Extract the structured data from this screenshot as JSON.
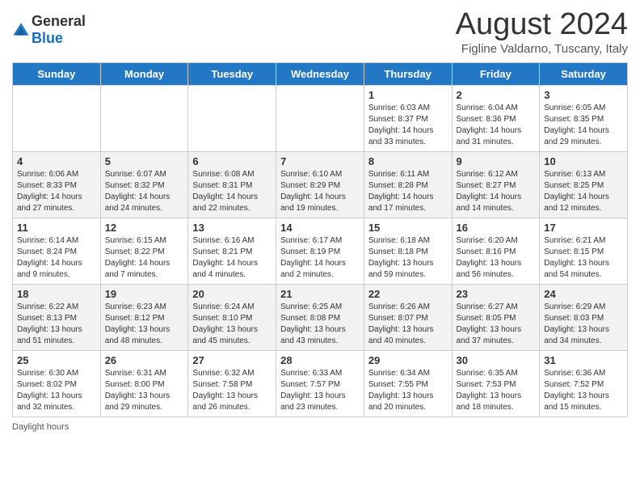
{
  "header": {
    "logo_general": "General",
    "logo_blue": "Blue",
    "title": "August 2024",
    "subtitle": "Figline Valdarno, Tuscany, Italy"
  },
  "days_of_week": [
    "Sunday",
    "Monday",
    "Tuesday",
    "Wednesday",
    "Thursday",
    "Friday",
    "Saturday"
  ],
  "weeks": [
    [
      {
        "day": "",
        "info": ""
      },
      {
        "day": "",
        "info": ""
      },
      {
        "day": "",
        "info": ""
      },
      {
        "day": "",
        "info": ""
      },
      {
        "day": "1",
        "info": "Sunrise: 6:03 AM\nSunset: 8:37 PM\nDaylight: 14 hours and 33 minutes."
      },
      {
        "day": "2",
        "info": "Sunrise: 6:04 AM\nSunset: 8:36 PM\nDaylight: 14 hours and 31 minutes."
      },
      {
        "day": "3",
        "info": "Sunrise: 6:05 AM\nSunset: 8:35 PM\nDaylight: 14 hours and 29 minutes."
      }
    ],
    [
      {
        "day": "4",
        "info": "Sunrise: 6:06 AM\nSunset: 8:33 PM\nDaylight: 14 hours and 27 minutes."
      },
      {
        "day": "5",
        "info": "Sunrise: 6:07 AM\nSunset: 8:32 PM\nDaylight: 14 hours and 24 minutes."
      },
      {
        "day": "6",
        "info": "Sunrise: 6:08 AM\nSunset: 8:31 PM\nDaylight: 14 hours and 22 minutes."
      },
      {
        "day": "7",
        "info": "Sunrise: 6:10 AM\nSunset: 8:29 PM\nDaylight: 14 hours and 19 minutes."
      },
      {
        "day": "8",
        "info": "Sunrise: 6:11 AM\nSunset: 8:28 PM\nDaylight: 14 hours and 17 minutes."
      },
      {
        "day": "9",
        "info": "Sunrise: 6:12 AM\nSunset: 8:27 PM\nDaylight: 14 hours and 14 minutes."
      },
      {
        "day": "10",
        "info": "Sunrise: 6:13 AM\nSunset: 8:25 PM\nDaylight: 14 hours and 12 minutes."
      }
    ],
    [
      {
        "day": "11",
        "info": "Sunrise: 6:14 AM\nSunset: 8:24 PM\nDaylight: 14 hours and 9 minutes."
      },
      {
        "day": "12",
        "info": "Sunrise: 6:15 AM\nSunset: 8:22 PM\nDaylight: 14 hours and 7 minutes."
      },
      {
        "day": "13",
        "info": "Sunrise: 6:16 AM\nSunset: 8:21 PM\nDaylight: 14 hours and 4 minutes."
      },
      {
        "day": "14",
        "info": "Sunrise: 6:17 AM\nSunset: 8:19 PM\nDaylight: 14 hours and 2 minutes."
      },
      {
        "day": "15",
        "info": "Sunrise: 6:18 AM\nSunset: 8:18 PM\nDaylight: 13 hours and 59 minutes."
      },
      {
        "day": "16",
        "info": "Sunrise: 6:20 AM\nSunset: 8:16 PM\nDaylight: 13 hours and 56 minutes."
      },
      {
        "day": "17",
        "info": "Sunrise: 6:21 AM\nSunset: 8:15 PM\nDaylight: 13 hours and 54 minutes."
      }
    ],
    [
      {
        "day": "18",
        "info": "Sunrise: 6:22 AM\nSunset: 8:13 PM\nDaylight: 13 hours and 51 minutes."
      },
      {
        "day": "19",
        "info": "Sunrise: 6:23 AM\nSunset: 8:12 PM\nDaylight: 13 hours and 48 minutes."
      },
      {
        "day": "20",
        "info": "Sunrise: 6:24 AM\nSunset: 8:10 PM\nDaylight: 13 hours and 45 minutes."
      },
      {
        "day": "21",
        "info": "Sunrise: 6:25 AM\nSunset: 8:08 PM\nDaylight: 13 hours and 43 minutes."
      },
      {
        "day": "22",
        "info": "Sunrise: 6:26 AM\nSunset: 8:07 PM\nDaylight: 13 hours and 40 minutes."
      },
      {
        "day": "23",
        "info": "Sunrise: 6:27 AM\nSunset: 8:05 PM\nDaylight: 13 hours and 37 minutes."
      },
      {
        "day": "24",
        "info": "Sunrise: 6:29 AM\nSunset: 8:03 PM\nDaylight: 13 hours and 34 minutes."
      }
    ],
    [
      {
        "day": "25",
        "info": "Sunrise: 6:30 AM\nSunset: 8:02 PM\nDaylight: 13 hours and 32 minutes."
      },
      {
        "day": "26",
        "info": "Sunrise: 6:31 AM\nSunset: 8:00 PM\nDaylight: 13 hours and 29 minutes."
      },
      {
        "day": "27",
        "info": "Sunrise: 6:32 AM\nSunset: 7:58 PM\nDaylight: 13 hours and 26 minutes."
      },
      {
        "day": "28",
        "info": "Sunrise: 6:33 AM\nSunset: 7:57 PM\nDaylight: 13 hours and 23 minutes."
      },
      {
        "day": "29",
        "info": "Sunrise: 6:34 AM\nSunset: 7:55 PM\nDaylight: 13 hours and 20 minutes."
      },
      {
        "day": "30",
        "info": "Sunrise: 6:35 AM\nSunset: 7:53 PM\nDaylight: 13 hours and 18 minutes."
      },
      {
        "day": "31",
        "info": "Sunrise: 6:36 AM\nSunset: 7:52 PM\nDaylight: 13 hours and 15 minutes."
      }
    ]
  ],
  "footer": {
    "note": "Daylight hours"
  }
}
